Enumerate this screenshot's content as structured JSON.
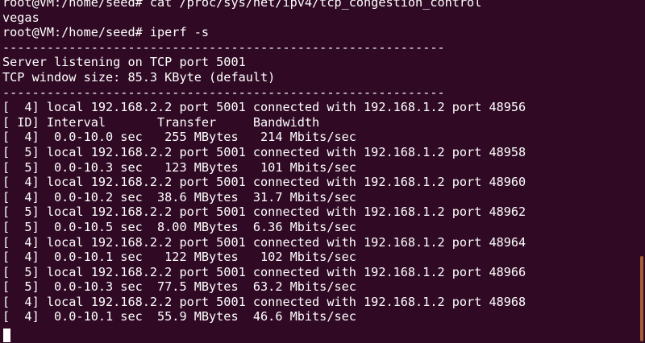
{
  "terminal": {
    "lines": [
      "root@VM:/home/seed# cat /proc/sys/net/ipv4/tcp_congestion_control",
      "vegas",
      "root@VM:/home/seed# iperf -s",
      "------------------------------------------------------------",
      "Server listening on TCP port 5001",
      "TCP window size: 85.3 KByte (default)",
      "------------------------------------------------------------",
      "[  4] local 192.168.2.2 port 5001 connected with 192.168.1.2 port 48956",
      "[ ID] Interval       Transfer     Bandwidth",
      "[  4]  0.0-10.0 sec   255 MBytes   214 Mbits/sec",
      "[  5] local 192.168.2.2 port 5001 connected with 192.168.1.2 port 48958",
      "[  5]  0.0-10.3 sec   123 MBytes   101 Mbits/sec",
      "[  4] local 192.168.2.2 port 5001 connected with 192.168.1.2 port 48960",
      "[  4]  0.0-10.2 sec  38.6 MBytes  31.7 Mbits/sec",
      "[  5] local 192.168.2.2 port 5001 connected with 192.168.1.2 port 48962",
      "[  5]  0.0-10.5 sec  8.00 MBytes  6.36 Mbits/sec",
      "[  4] local 192.168.2.2 port 5001 connected with 192.168.1.2 port 48964",
      "[  4]  0.0-10.1 sec   122 MBytes   102 Mbits/sec",
      "[  5] local 192.168.2.2 port 5001 connected with 192.168.1.2 port 48966",
      "[  5]  0.0-10.3 sec  77.5 MBytes  63.2 Mbits/sec",
      "[  4] local 192.168.2.2 port 5001 connected with 192.168.1.2 port 48968",
      "[  4]  0.0-10.1 sec  55.9 MBytes  46.6 Mbits/sec"
    ]
  },
  "colors": {
    "background": "#300a24",
    "foreground": "#ffffff",
    "scrollbar": "#a45d34"
  }
}
